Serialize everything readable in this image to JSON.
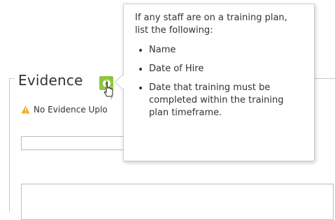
{
  "evidence": {
    "legend": "Evidence",
    "warning_text": "No Evidence Uplo",
    "accent_color": "#8dc63f",
    "warning_color": "#f0ad1e"
  },
  "tooltip": {
    "intro": "If any staff are on a training plan, list the following:",
    "items": [
      "Name",
      "Date of Hire",
      "Date that training must be completed within the training plan timeframe."
    ]
  },
  "icons": {
    "help": "question-icon",
    "warning": "warning-triangle-icon",
    "cursor": "hand-pointer-cursor-icon"
  }
}
